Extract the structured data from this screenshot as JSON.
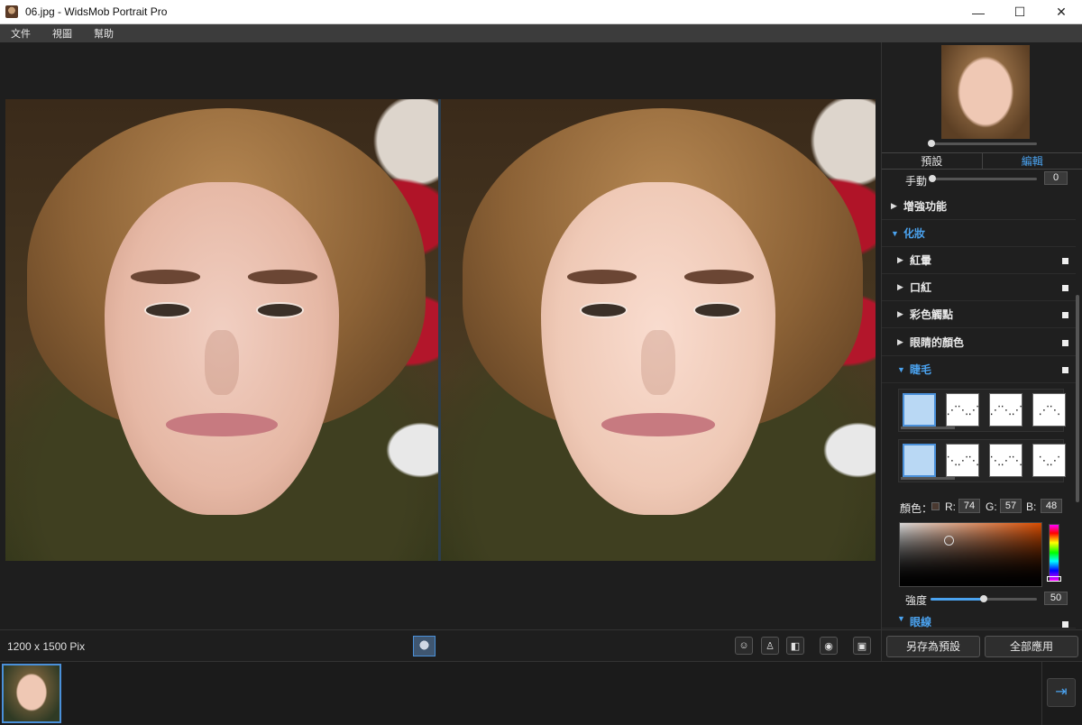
{
  "window": {
    "title": "06.jpg - WidsMob Portrait Pro",
    "minimize": "—",
    "maximize": "☐",
    "close": "✕"
  },
  "menu": [
    "文件",
    "視圖",
    "幫助"
  ],
  "status": {
    "dimensions": "1200 x 1500 Pix"
  },
  "toolbar_icons": [
    "face-retouch-icon",
    "portrait-icon",
    "compare-split-icon",
    "preview-eye-icon",
    "frame-icon"
  ],
  "right_panel": {
    "tabs": [
      {
        "label": "預設",
        "active": false
      },
      {
        "label": "編輯",
        "active": true
      }
    ],
    "manual": {
      "label": "手動",
      "value": "0"
    },
    "sections": {
      "enhance": "增強功能",
      "makeup": "化妝",
      "blush": "紅暈",
      "lipstick": "口紅",
      "color_contacts": "彩色觸點",
      "eye_color": "眼睛的顏色",
      "eyelash": "睫毛",
      "eyeliner": "眼線"
    },
    "color": {
      "label": "顏色：",
      "r_label": "R:",
      "r": "74",
      "g_label": "G:",
      "g": "57",
      "b_label": "B:",
      "b": "48"
    },
    "strength": {
      "label": "強度",
      "value": "50",
      "fraction": 0.5
    },
    "buttons": {
      "save_preset": "另存為預設",
      "apply_all": "全部應用"
    }
  },
  "colors": {
    "accent": "#4ba3f0",
    "selected_color": "#4a3930"
  }
}
